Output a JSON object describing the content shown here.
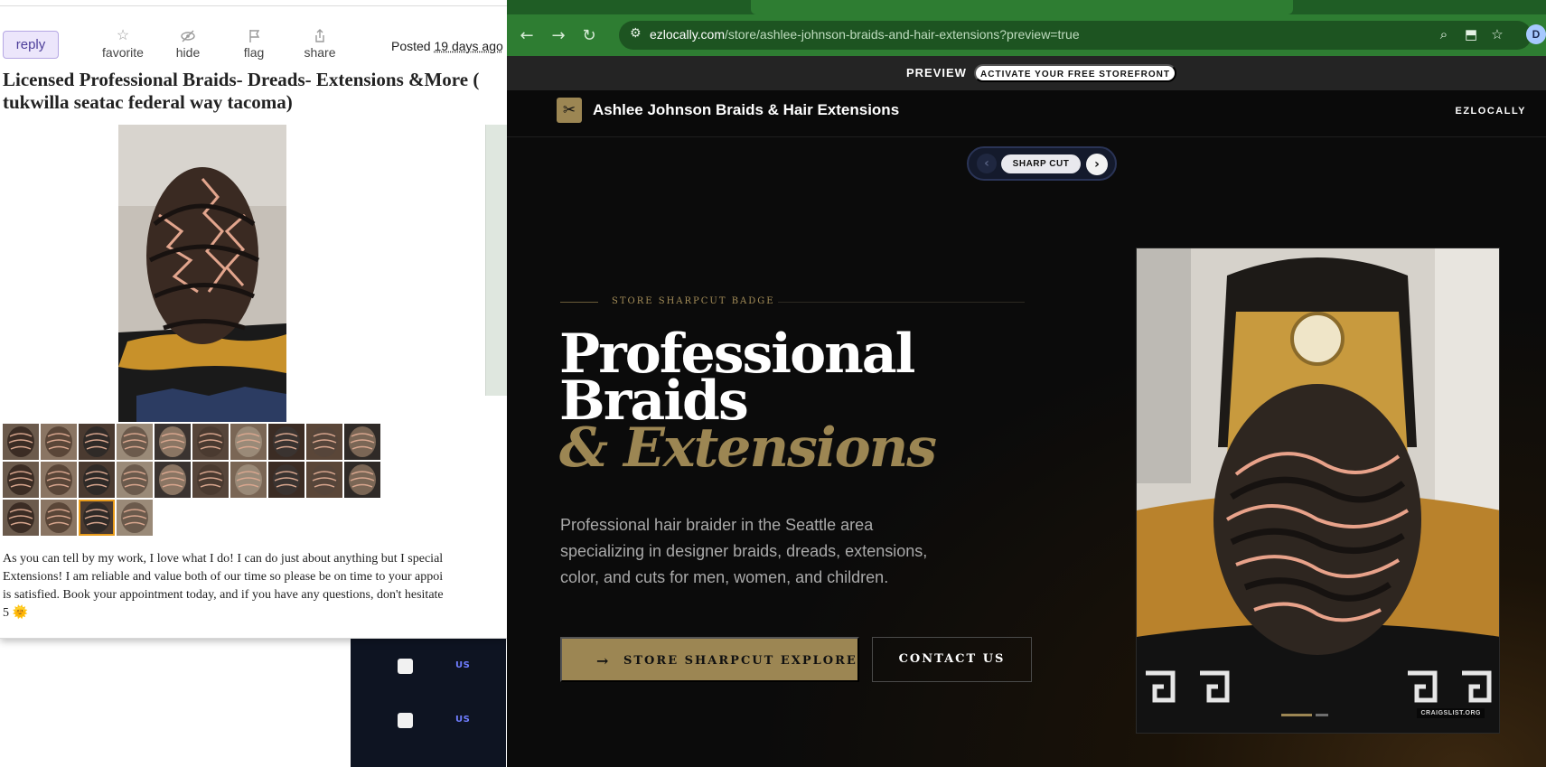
{
  "craigslist": {
    "reply_label": "reply",
    "actions": [
      {
        "label": "favorite",
        "icon": "star-icon"
      },
      {
        "label": "hide",
        "icon": "eye-slash-icon"
      },
      {
        "label": "flag",
        "icon": "flag-icon"
      },
      {
        "label": "share",
        "icon": "share-icon"
      }
    ],
    "posted_prefix": "Posted",
    "posted_ago": "19 days ago",
    "title_line1": "Licensed Professional Braids- Dreads- Extensions &More (",
    "title_line2": "tukwilla seatac federal way tacoma)",
    "description_lines": [
      "As you can tell by my work, I love what I do! I can do just about anything but I special",
      "Extensions! I am reliable and value both of our time so please be on time to your appoi",
      "is satisfied. Book your appointment today, and if you have any questions, don't hesitate",
      "5 🌞"
    ],
    "thumbnail_count": 24,
    "selected_thumbnail": 22
  },
  "background_app": {
    "rows": [
      {
        "badge": "US"
      },
      {
        "badge": "US"
      }
    ]
  },
  "browser": {
    "url_host": "ezlocally.com",
    "url_path": "/store/ashlee-johnson-braids-and-hair-extensions?preview=true",
    "profile_initial": "D",
    "colors": {
      "toolbar": "#2e7d32",
      "accent_gold": "#9c8653"
    }
  },
  "preview_bar": {
    "label": "PREVIEW",
    "cta": "ACTIVATE YOUR FREE STOREFRONT"
  },
  "site": {
    "brand_name": "Ashlee Johnson Braids & Hair Extensions",
    "brand_right": "EZLOCALLY",
    "theme_switcher": {
      "current": "SHARP CUT"
    },
    "hero": {
      "eyebrow": "STORE SHARPCUT BADGE",
      "title_line1": "Professional",
      "title_line2": "Braids",
      "title_accent": "& Extensions",
      "subtitle": "Professional hair braider in the Seattle area specializing in designer braids, dreads, extensions, color, and cuts for men, women, and children.",
      "primary_button": "STORE SHARPCUT EXPLORE",
      "secondary_button": "CONTACT US",
      "image_credit": "CRAIGSLIST.ORG"
    }
  }
}
